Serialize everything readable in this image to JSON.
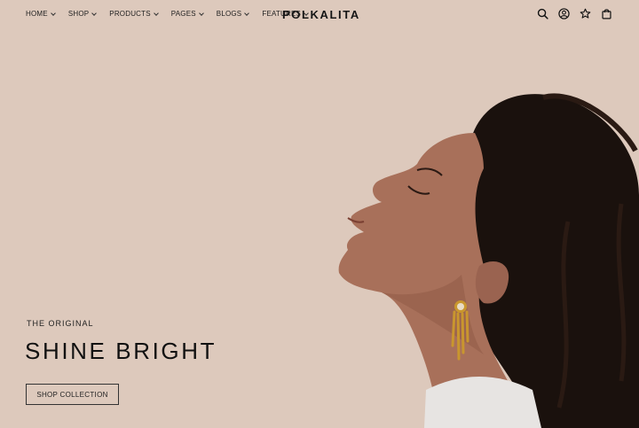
{
  "brand": {
    "logo": "POLKALITA"
  },
  "nav": {
    "items": [
      {
        "label": "HOME"
      },
      {
        "label": "SHOP"
      },
      {
        "label": "PRODUCTS"
      },
      {
        "label": "PAGES"
      },
      {
        "label": "BLOGS"
      },
      {
        "label": "FEATURES"
      }
    ]
  },
  "header_icons": [
    "search-icon",
    "account-icon",
    "wishlist-star-icon",
    "cart-bag-icon"
  ],
  "hero": {
    "eyebrow": "THE ORIGINAL",
    "headline": "SHINE BRIGHT",
    "cta_label": "SHOP COLLECTION"
  },
  "colors": {
    "background": "#ddc9bc",
    "text": "#1b1b1b",
    "hair": "#1a110d",
    "skin": "#a8705a",
    "earring_gold": "#c9962e",
    "sweater": "#e7e4e2"
  }
}
